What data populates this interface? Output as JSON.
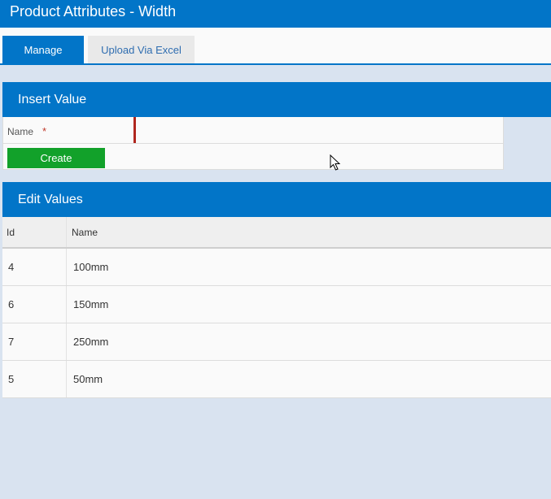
{
  "header": {
    "title": "Product Attributes - Width"
  },
  "tabs": [
    {
      "label": "Manage",
      "active": true
    },
    {
      "label": "Upload Via Excel",
      "active": false
    }
  ],
  "insert": {
    "title": "Insert Value",
    "name_label": "Name",
    "required_mark": "*",
    "name_value": "",
    "create_label": "Create"
  },
  "edit": {
    "title": "Edit Values",
    "columns": [
      "Id",
      "Name"
    ],
    "rows": [
      {
        "id": "4",
        "name": "100mm"
      },
      {
        "id": "6",
        "name": "150mm"
      },
      {
        "id": "7",
        "name": "250mm"
      },
      {
        "id": "5",
        "name": "50mm"
      }
    ]
  },
  "colors": {
    "primary": "#0275c8",
    "success": "#12a12a",
    "background": "#d9e3f0",
    "required": "#c0392b"
  },
  "icons": {
    "cursor": "mouse-pointer-icon"
  }
}
